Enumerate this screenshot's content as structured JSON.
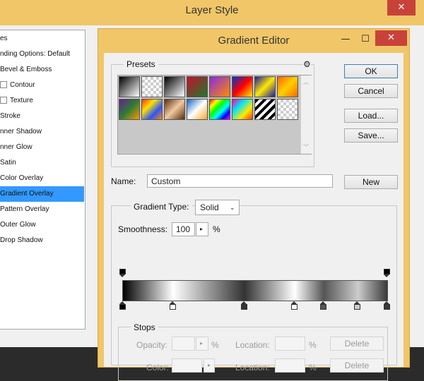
{
  "layer_style": {
    "title": "Layer Style",
    "close_glyph": "✕",
    "list_items": [
      {
        "label": "es",
        "checkbox": false,
        "selected": false
      },
      {
        "label": "nding Options: Default",
        "checkbox": false,
        "selected": false
      },
      {
        "label": "Bevel & Emboss",
        "checkbox": false,
        "selected": false
      },
      {
        "label": "Contour",
        "checkbox": true,
        "selected": false
      },
      {
        "label": "Texture",
        "checkbox": true,
        "selected": false
      },
      {
        "label": "Stroke",
        "checkbox": false,
        "selected": false
      },
      {
        "label": "nner Shadow",
        "checkbox": false,
        "selected": false
      },
      {
        "label": "nner Glow",
        "checkbox": false,
        "selected": false
      },
      {
        "label": "Satin",
        "checkbox": false,
        "selected": false
      },
      {
        "label": "Color Overlay",
        "checkbox": false,
        "selected": false
      },
      {
        "label": "Gradient Overlay",
        "checkbox": false,
        "selected": true
      },
      {
        "label": "Pattern Overlay",
        "checkbox": false,
        "selected": false
      },
      {
        "label": "Outer Glow",
        "checkbox": false,
        "selected": false
      },
      {
        "label": "Drop Shadow",
        "checkbox": false,
        "selected": false
      }
    ]
  },
  "gradient_editor": {
    "title": "Gradient Editor",
    "minimize_glyph": "—",
    "maximize_glyph": "☐",
    "close_glyph": "✕",
    "presets": {
      "label": "Presets",
      "menu_icon": "gear-icon",
      "menu_glyph": "⚙",
      "swatches": [
        "linear-gradient(135deg,#000,#fff)",
        "checker",
        "linear-gradient(135deg,#000,#fff)",
        "linear-gradient(135deg,#c8102e,#1a7a2a)",
        "linear-gradient(135deg,#8a2be2,#ff8c00)",
        "linear-gradient(135deg,#0033cc,#ff0000,#ffee00)",
        "linear-gradient(135deg,#1a1aa8,#ffe800,#1a1aa8)",
        "linear-gradient(135deg,#ff6600,#ffd000,#ff6600)",
        "linear-gradient(135deg,#6a1b9a,#2e7d32,#ff9800)",
        "linear-gradient(135deg,#ff3300,#ffe000,#2b55ff,#ff8800)",
        "linear-gradient(135deg,#5a2d0c,#f0c9a0,#5a2d0c)",
        "linear-gradient(135deg,#1565c0,#ffffff,#f9a825)",
        "linear-gradient(135deg,#ff0000,#ffff00,#00ff00,#00ffff,#0000ff,#ff00ff)",
        "linear-gradient(135deg,#ff00aa,#00e5ff,#ffea00,#ff3d00)",
        "repeating-linear-gradient(135deg,#000 0 4px,#fff 4px 8px)",
        "checker"
      ]
    },
    "buttons": {
      "ok": "OK",
      "cancel": "Cancel",
      "load": "Load...",
      "save": "Save...",
      "new": "New"
    },
    "name": {
      "label": "Name:",
      "value": "Custom"
    },
    "gradient_type": {
      "label": "Gradient Type:",
      "value": "Solid"
    },
    "smoothness": {
      "label": "Smoothness:",
      "value": "100",
      "unit": "%"
    },
    "stops": {
      "label": "Stops",
      "opacity_label": "Opacity:",
      "opacity_unit": "%",
      "location_label": "Location:",
      "location_unit": "%",
      "color_label": "Color:",
      "delete_label": "Delete",
      "opacity_stops_pct": [
        0,
        100
      ],
      "color_stops": [
        {
          "pct": 0,
          "color": "#000000"
        },
        {
          "pct": 19,
          "color": "#ffffff"
        },
        {
          "pct": 46,
          "color": "#333333"
        },
        {
          "pct": 65,
          "color": "#ffffff"
        },
        {
          "pct": 76,
          "color": "#555555"
        },
        {
          "pct": 89,
          "color": "#cccccc"
        },
        {
          "pct": 100,
          "color": "#3a3a3a"
        }
      ]
    }
  }
}
